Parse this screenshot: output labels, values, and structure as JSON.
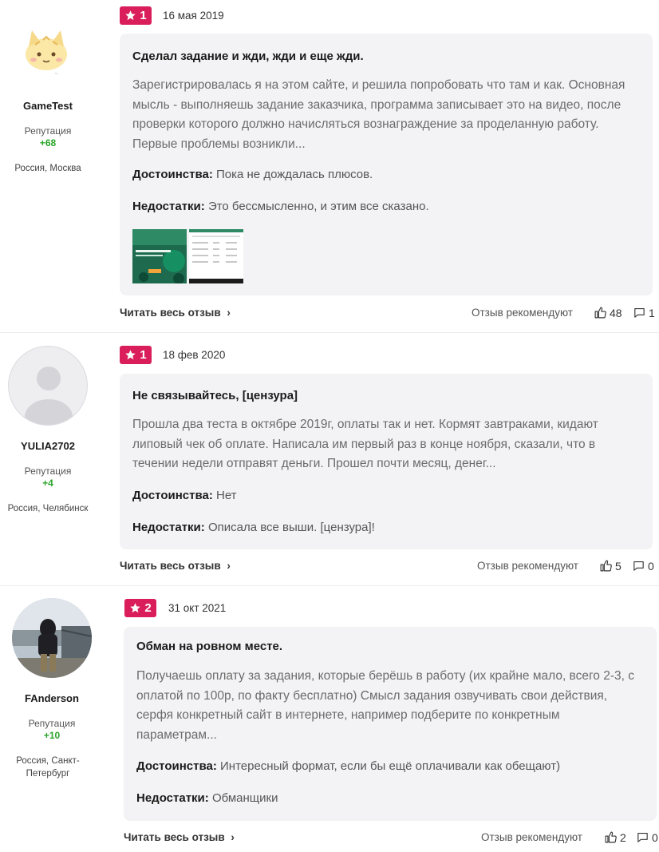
{
  "labels": {
    "reputation": "Репутация",
    "read_more": "Читать весь отзыв",
    "recommend": "Отзыв рекомендуют",
    "pros": "Достоинства:",
    "cons": "Недостатки:"
  },
  "colors": {
    "rating_badge": "#d91e5b",
    "reputation_positive": "#2aa52a",
    "card_background": "#f3f3f5"
  },
  "reviews": [
    {
      "author": "GameTest",
      "reputation": "+68",
      "location": "Россия, Москва",
      "avatar_icon": "cat-avatar",
      "rating": "1",
      "date": "16 мая 2019",
      "title": "Сделал задание и жди, жди и еще жди.",
      "body": "Зарегистрировалась я на этом сайте, и решила попробовать что там и как. Основная мысль - выполняешь задание заказчика, программа записывает это на видео, после проверки которого должно начисляться вознаграждение за проделанную работу. Первые проблемы возникли...",
      "pros": "Пока не дождалась плюсов.",
      "cons": "Это бессмысленно, и этим все сказано.",
      "likes": "48",
      "comments": "1"
    },
    {
      "author": "YULIA2702",
      "reputation": "+4",
      "location": "Россия, Челябинск",
      "avatar_icon": "default-user-avatar",
      "rating": "1",
      "date": "18 фев 2020",
      "title": "Не связывайтесь, [цензура]",
      "body": "Прошла два теста в октябре 2019г, оплаты так и нет. Кормят завтраками, кидают липовый чек об оплате. Написала им первый раз в конце ноября, сказали, что в течении недели отправят деньги. Прошел почти месяц, денег...",
      "pros": "Нет",
      "cons": "Описала все выши. [цензура]!",
      "likes": "5",
      "comments": "0"
    },
    {
      "author": "FAnderson",
      "reputation": "+10",
      "location": "Россия, Санкт-Петербург",
      "avatar_icon": "photo-avatar",
      "rating": "2",
      "date": "31 окт 2021",
      "title": "Обман на ровном месте.",
      "body": "Получаешь оплату за задания, которые берёшь в работу (их крайне мало, всего 2-3, с оплатой по 100р, по факту бесплатно) Смысл задания озвучивать свои действия, серфя конкретный сайт в интернете, например подберите по конкретным параметрам...",
      "pros": "Интересный формат, если бы ещё оплачивали как обещают)",
      "cons": "Обманщики",
      "likes": "2",
      "comments": "0"
    }
  ]
}
